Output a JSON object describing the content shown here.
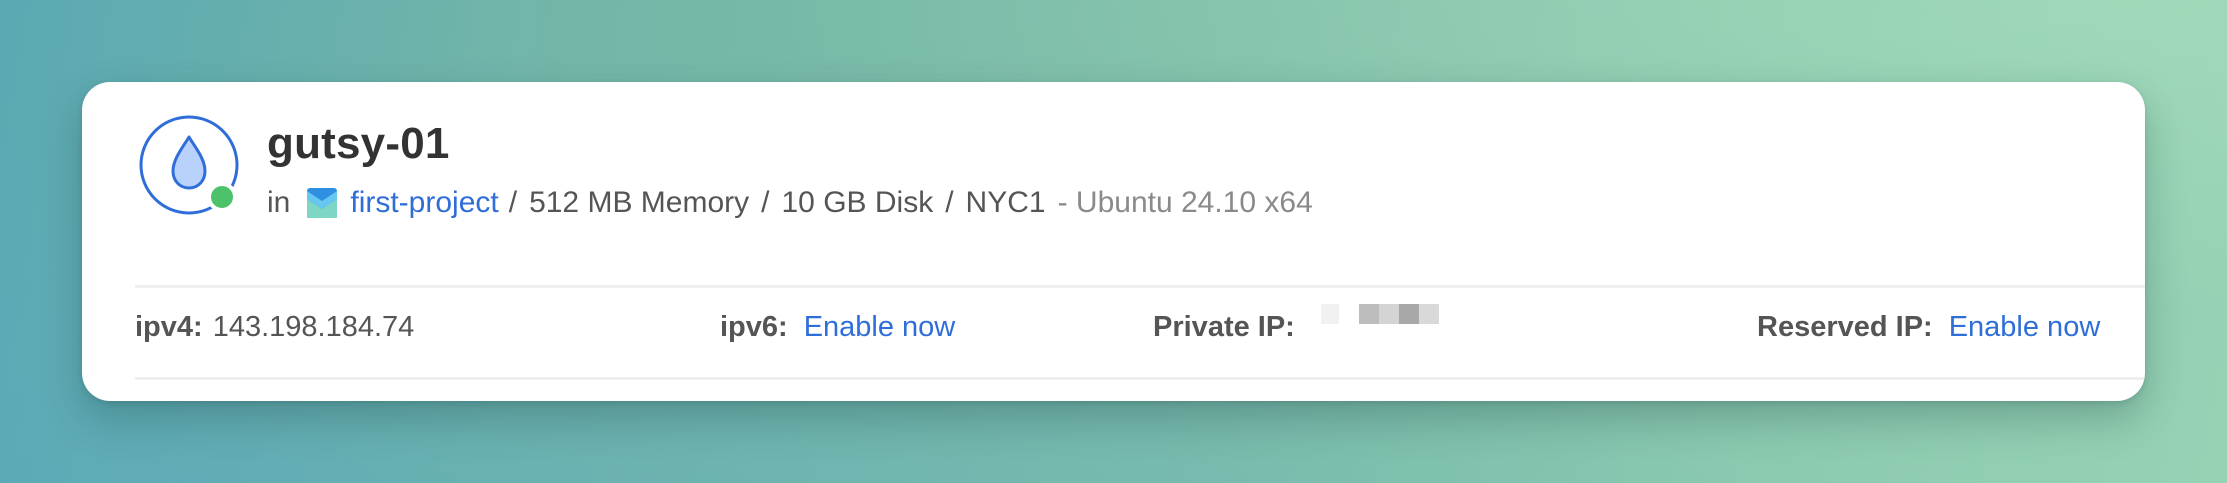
{
  "droplet": {
    "name": "gutsy-01",
    "in_label": "in",
    "project_name": "first-project",
    "memory": "512 MB Memory",
    "disk": "10 GB Disk",
    "region": "NYC1",
    "separator": "/",
    "os": "- Ubuntu 24.10 x64",
    "status_color": "#4cc36a",
    "icon": "droplet-icon"
  },
  "networking": {
    "ipv4": {
      "label": "ipv4:",
      "value": "143.198.184.74"
    },
    "ipv6": {
      "label": "ipv6:",
      "action": "Enable now"
    },
    "private_ip": {
      "label": "Private IP:"
    },
    "reserved_ip": {
      "label": "Reserved IP:",
      "action": "Enable now"
    }
  },
  "colors": {
    "link": "#2f6ed8",
    "title": "#333333",
    "text": "#555555",
    "muted": "#8a8a8a"
  }
}
